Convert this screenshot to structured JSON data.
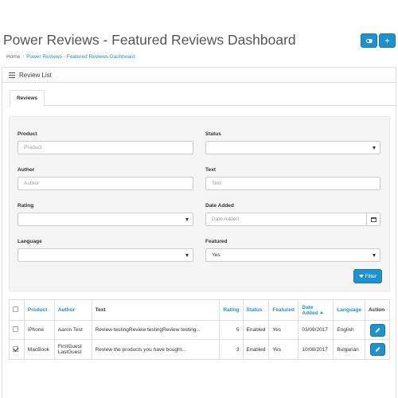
{
  "header": {
    "title": "Power Reviews - Featured Reviews Dashboard",
    "toggle_icon": "toggle-icon",
    "add_label": "+"
  },
  "breadcrumb": {
    "home": "Home",
    "current": "Power Reviews - Featured Reviews Dashboard"
  },
  "panel": {
    "title": "Review List",
    "tab": "Reviews"
  },
  "filters": {
    "product_label": "Product",
    "product_placeholder": "Product",
    "status_label": "Status",
    "status_value": "",
    "author_label": "Author",
    "author_placeholder": "Author",
    "text_label": "Text",
    "text_placeholder": "Text",
    "rating_label": "Rating",
    "rating_value": "",
    "date_label": "Date Added",
    "date_placeholder": "Date Added",
    "language_label": "Language",
    "language_value": "",
    "featured_label": "Featured",
    "featured_value": "Yes",
    "filter_button": "Filter"
  },
  "table": {
    "columns": [
      "Product",
      "Author",
      "Text",
      "Rating",
      "Status",
      "Featured",
      "Date Added",
      "Language",
      "Action"
    ],
    "rows": [
      {
        "checked": false,
        "product": "iPhone",
        "author": "Aaron Test",
        "text": "Review testingReview testingReview testing...",
        "rating": "5",
        "status": "Enabled",
        "featured": "Yes",
        "date": "03/09/2017",
        "language": "English"
      },
      {
        "checked": true,
        "product": "MacBook",
        "author": "FirstGuest LastGuest",
        "text": "Review the products you have bought...",
        "rating": "3",
        "status": "Enabled",
        "featured": "Yes",
        "date": "10/08/2017",
        "language": "Bulgarian"
      }
    ]
  },
  "colors": {
    "primary": "#1e91cf",
    "filter_bg": "#f5f5f5"
  }
}
